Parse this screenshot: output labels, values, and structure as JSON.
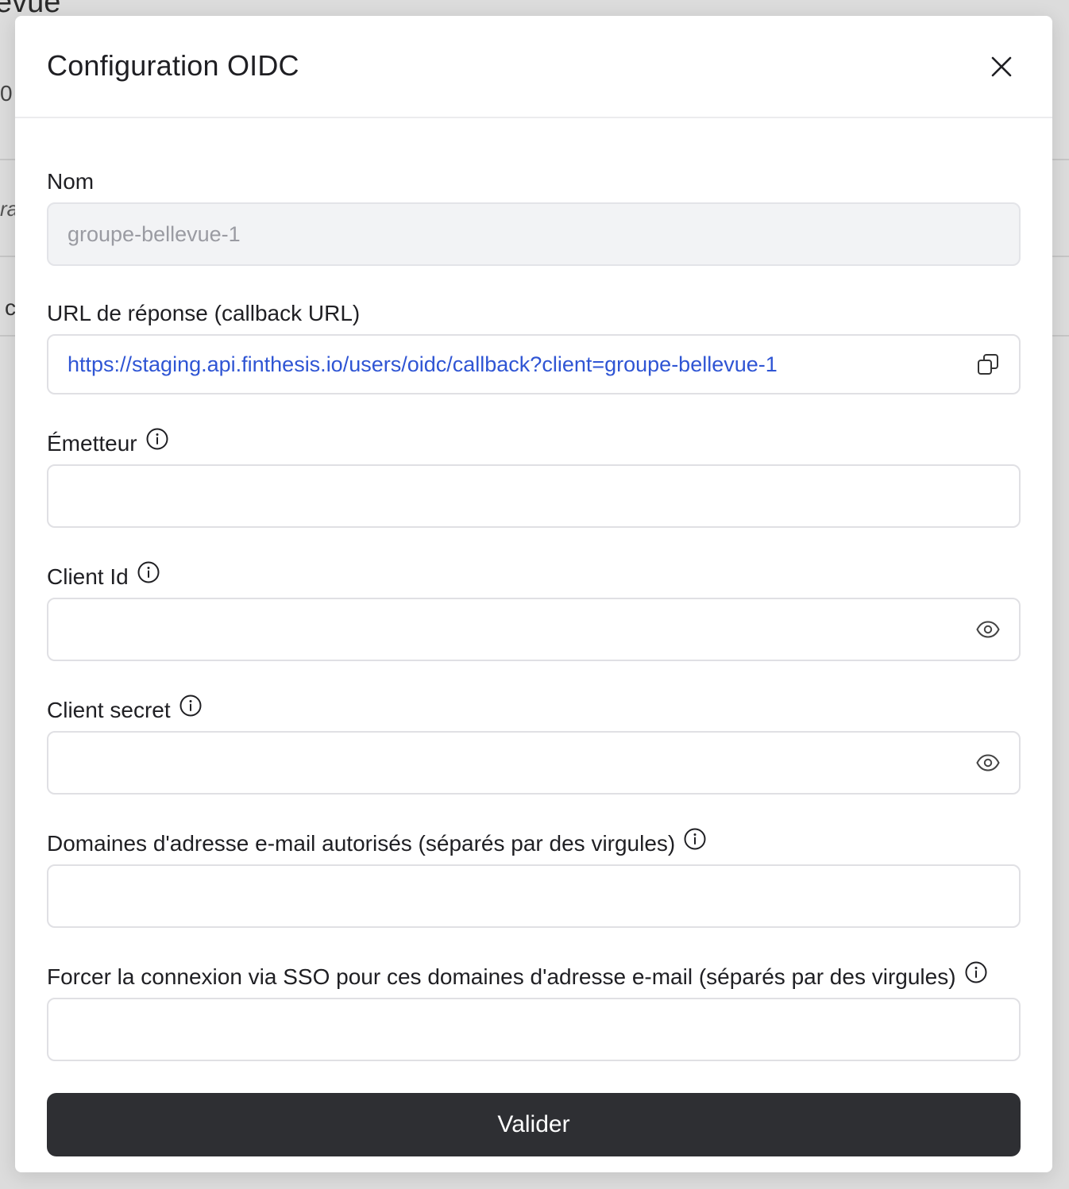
{
  "background": {
    "title_fragment": "evue",
    "sub_fragment": "0",
    "italic_fragment": "ra",
    "c_fragment": "c"
  },
  "modal": {
    "title": "Configuration OIDC",
    "fields": {
      "name": {
        "label": "Nom",
        "value": "groupe-bellevue-1"
      },
      "callback_url": {
        "label": "URL de réponse (callback URL)",
        "value": "https://staging.api.finthesis.io/users/oidc/callback?client=groupe-bellevue-1"
      },
      "issuer": {
        "label": "Émetteur",
        "value": ""
      },
      "client_id": {
        "label": "Client Id",
        "value": ""
      },
      "client_secret": {
        "label": "Client secret",
        "value": ""
      },
      "allowed_domains": {
        "label": "Domaines d'adresse e-mail autorisés (séparés par des virgules)",
        "value": ""
      },
      "forced_sso_domains": {
        "label": "Forcer la connexion via SSO pour ces domaines d'adresse e-mail (séparés par des virgules)",
        "value": ""
      }
    },
    "submit_label": "Valider"
  },
  "icons": {
    "close": "close-icon",
    "copy": "copy-icon",
    "info": "info-icon",
    "eye": "eye-icon"
  },
  "colors": {
    "link": "#2f55d4",
    "button_bg": "#2e2f33",
    "disabled_bg": "#f2f3f5"
  }
}
